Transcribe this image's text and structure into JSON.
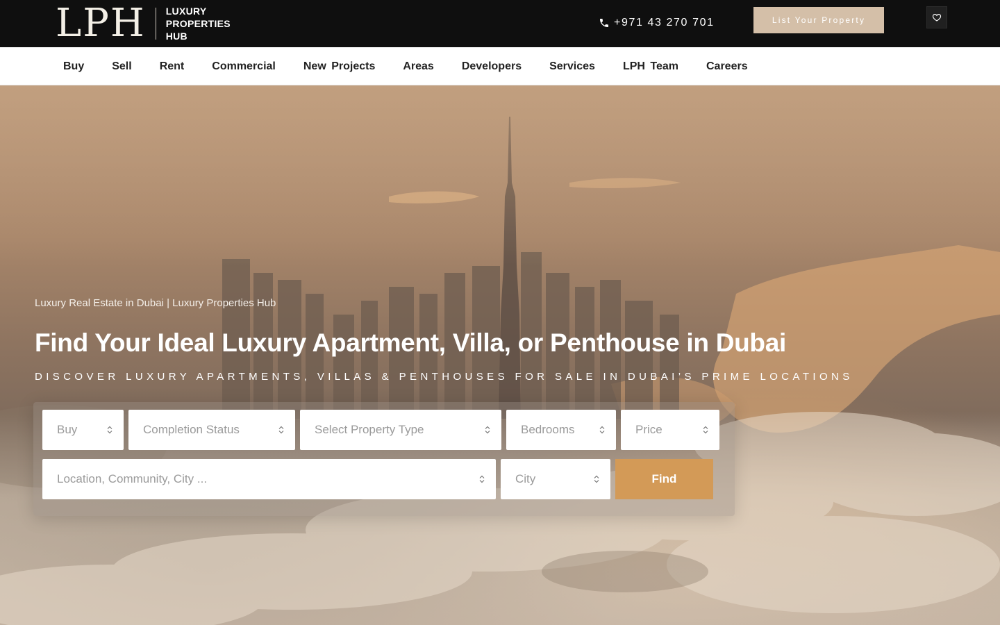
{
  "header": {
    "logo": {
      "mark": "LPH",
      "lines": [
        "LUXURY",
        "PROPERTIES",
        "HUB"
      ]
    },
    "phone": {
      "icon": "phone-icon",
      "number": "+971 43 270 701"
    },
    "list_property_label": "List Your Property",
    "favorites_icon": "heart-icon",
    "accent_color": "#d4bfa8"
  },
  "nav": {
    "items": [
      "Buy",
      "Sell",
      "Rent",
      "Commercial",
      "New Projects",
      "Areas",
      "Developers",
      "Services",
      "LPH Team",
      "Careers"
    ]
  },
  "hero": {
    "breadcrumb": "Luxury Real Estate in Dubai | Luxury Properties Hub",
    "title": "Find Your Ideal Luxury Apartment, Villa, or Penthouse in Dubai",
    "subtitle": "DISCOVER LUXURY APARTMENTS, VILLAS & PENTHOUSES FOR SALE IN DUBAI’S PRIME LOCATIONS"
  },
  "search": {
    "listing_type": "Buy",
    "completion_status": "Completion Status",
    "property_type": "Select Property Type",
    "bedrooms": "Bedrooms",
    "price": "Price",
    "location_placeholder": "Location, Community, City ...",
    "city": "City",
    "find_label": "Find",
    "find_color": "#d39a57"
  }
}
